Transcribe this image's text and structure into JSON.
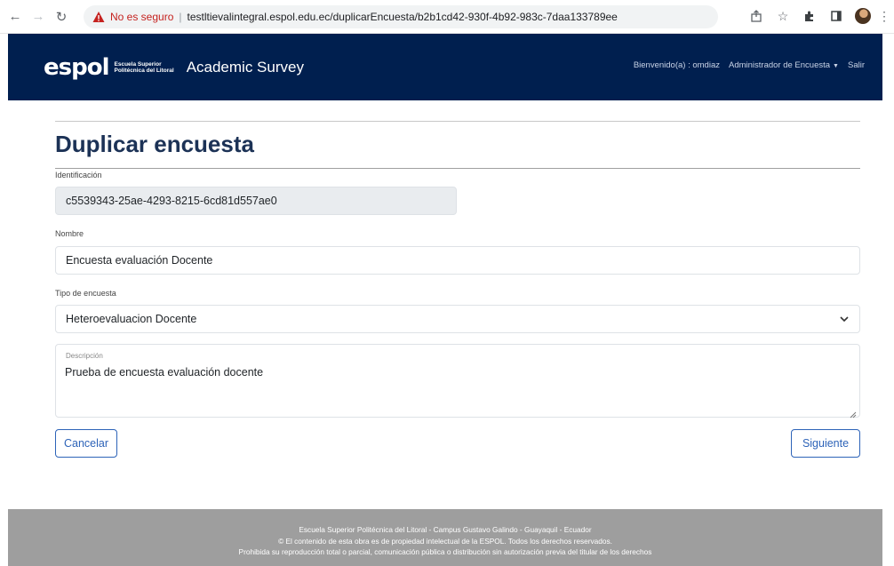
{
  "browser": {
    "security_text": "No es seguro",
    "separator": "|",
    "url": "testltievalintegral.espol.edu.ec/duplicarEncuesta/b2b1cd42-930f-4b92-983c-7daa133789ee"
  },
  "header": {
    "logo_word": "espol",
    "logo_sub_line1": "Escuela Superior",
    "logo_sub_line2": "Politécnica del Litoral",
    "brand": "Academic Survey",
    "welcome": "Bienvenido(a) : omdiaz",
    "role_menu": "Administrador de Encuesta",
    "logout": "Salir",
    "bg_color": "#001f4f"
  },
  "form": {
    "title": "Duplicar encuesta",
    "identificacion_label": "Identificación",
    "identificacion_value": "c5539343-25ae-4293-8215-6cd81d557ae0",
    "nombre_label": "Nombre",
    "nombre_value": "Encuesta evaluación Docente",
    "tipo_label": "Tipo de encuesta",
    "tipo_value": "Heteroevaluacion Docente",
    "descripcion_label": "Descripción",
    "descripcion_value": "Prueba de encuesta evaluación docente",
    "cancel_label": "Cancelar",
    "next_label": "Siguiente",
    "accent_color": "#2d63b8"
  },
  "footer": {
    "line1": "Escuela Superior Politécnica del Litoral - Campus Gustavo Galindo - Guayaquil - Ecuador",
    "line2": "© El contenido de esta obra es de propiedad intelectual de la ESPOL. Todos los derechos reservados.",
    "line3": "Prohibida su reproducción total o parcial, comunicación pública o distribución sin autorización previa del titular de los derechos"
  }
}
